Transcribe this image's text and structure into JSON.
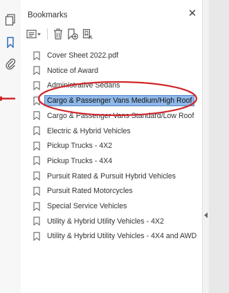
{
  "panel": {
    "title": "Bookmarks",
    "close_glyph": "✕"
  },
  "rail": {
    "icons": [
      "pages-icon",
      "bookmark-icon",
      "attachment-icon"
    ]
  },
  "toolbar": {
    "icons": [
      "options-menu-icon",
      "delete-bookmark-icon",
      "new-bookmark-icon",
      "bookmark-from-structure-icon"
    ]
  },
  "bookmarks": [
    {
      "label": "Cover Sheet 2022.pdf",
      "selected": false
    },
    {
      "label": "Notice of Award",
      "selected": false
    },
    {
      "label": "Administrative Sedans",
      "selected": false
    },
    {
      "label": "Cargo & Passenger Vans Medium/High Roof",
      "selected": true
    },
    {
      "label": "Cargo & Passenger Vans Standard/Low Roof",
      "selected": false
    },
    {
      "label": "Electric & Hybrid Vehicles",
      "selected": false
    },
    {
      "label": "Pickup Trucks - 4X2",
      "selected": false
    },
    {
      "label": "Pickup Trucks - 4X4",
      "selected": false
    },
    {
      "label": "Pursuit Rated & Pursuit Hybrid Vehicles",
      "selected": false
    },
    {
      "label": "Pursuit Rated Motorcycles",
      "selected": false
    },
    {
      "label": "Special Service Vehicles",
      "selected": false
    },
    {
      "label": "Utility & Hybrid Utility Vehicles - 4X2",
      "selected": false
    },
    {
      "label": "Utility & Hybrid Utility Vehicles - 4X4 and AWD",
      "selected": false
    }
  ],
  "colors": {
    "selection_fill": "#8fb8e8",
    "selection_border": "#4d88c8",
    "annotation_red": "#d0262b",
    "rail_accent": "#2a6ebd"
  }
}
